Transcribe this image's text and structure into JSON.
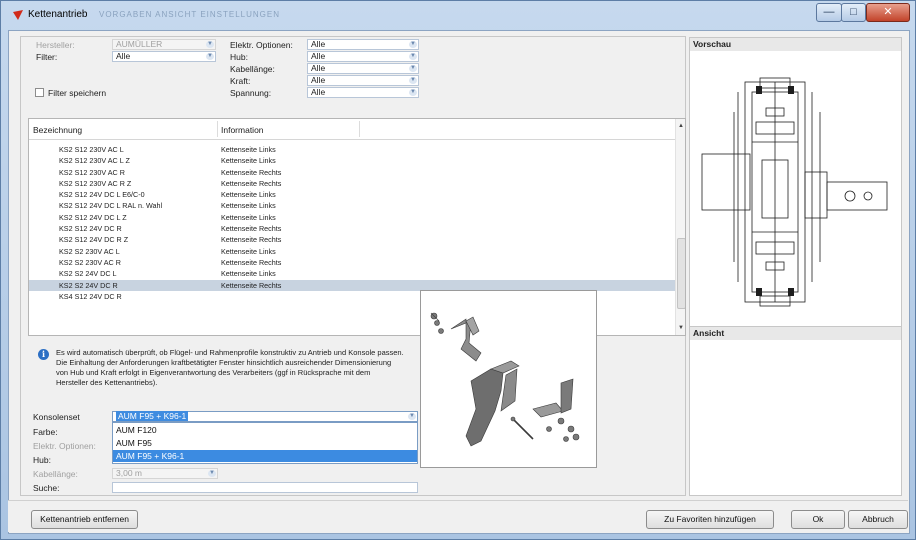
{
  "window": {
    "title": "Kettenantrieb",
    "ghost_menu": "VORGABEN ANSICHT EINSTELLUNGEN",
    "controls": {
      "minimize": "—",
      "maximize": "□",
      "close": "✕"
    }
  },
  "colors": {
    "accent": "#3c8be1",
    "selection_row": "#c8d3e0",
    "title_icon": "#d12a1a"
  },
  "filters": {
    "hersteller": {
      "label": "Hersteller:",
      "value": "AUMÜLLER"
    },
    "filter": {
      "label": "Filter:",
      "value": "Alle"
    },
    "filter_speichern": {
      "label": "Filter speichern",
      "checked": false
    },
    "elektr_optionen": {
      "label": "Elektr. Optionen:",
      "value": "Alle"
    },
    "hub": {
      "label": "Hub:",
      "value": "Alle"
    },
    "kabellaenge": {
      "label": "Kabellänge:",
      "value": "Alle"
    },
    "kraft": {
      "label": "Kraft:",
      "value": "Alle"
    },
    "spannung": {
      "label": "Spannung:",
      "value": "Alle"
    }
  },
  "list": {
    "columns": [
      "Bezeichnung",
      "Information"
    ],
    "rows": [
      {
        "name": "KS2 S12 230V AC L",
        "info": "Kettenseite Links"
      },
      {
        "name": "KS2 S12 230V AC L Z",
        "info": "Kettenseite Links"
      },
      {
        "name": "KS2 S12 230V AC R",
        "info": "Kettenseite Rechts"
      },
      {
        "name": "KS2 S12 230V AC R Z",
        "info": "Kettenseite Rechts"
      },
      {
        "name": "KS2 S12 24V DC L E6/C-0",
        "info": "Kettenseite Links"
      },
      {
        "name": "KS2 S12 24V DC L RAL n. Wahl",
        "info": "Kettenseite Links"
      },
      {
        "name": "KS2 S12 24V DC L Z",
        "info": "Kettenseite Links"
      },
      {
        "name": "KS2 S12 24V DC R",
        "info": "Kettenseite Rechts"
      },
      {
        "name": "KS2 S12 24V DC R Z",
        "info": "Kettenseite Rechts"
      },
      {
        "name": "KS2 S2 230V AC L",
        "info": "Kettenseite Links"
      },
      {
        "name": "KS2 S2 230V AC R",
        "info": "Kettenseite Rechts"
      },
      {
        "name": "KS2 S2 24V DC L",
        "info": "Kettenseite Links"
      },
      {
        "name": "KS2 S2 24V DC R",
        "info": "Kettenseite Rechts"
      },
      {
        "name": "KS4 S12 24V DC R",
        "info": ""
      }
    ],
    "selected_index": 12
  },
  "info_text": "Es wird automatisch überprüft, ob Flügel- und Rahmenprofile konstruktiv zu Antrieb und Konsole passen. Die Einhaltung der Anforderungen kraftbetätigter Fenster hinsichtlich ausreichender Dimensionierung von Hub und Kraft erfolgt in Eigenverantwortung des Verarbeiters (ggf in Rücksprache mit dem Hersteller des Kettenantriebs).",
  "form": {
    "konsolenset": {
      "label": "Konsolenset",
      "value": "AUM F95 + K96-1"
    },
    "farbe": {
      "label": "Farbe:"
    },
    "elektr_optionen": {
      "label": "Elektr. Optionen:"
    },
    "hub": {
      "label": "Hub:"
    },
    "kabellaenge": {
      "label": "Kabellänge:",
      "value": "3,00 m"
    },
    "suche": {
      "label": "Suche:",
      "value": ""
    },
    "dropdown_options": [
      "AUM F120",
      "AUM F95",
      "AUM F95 + K96-1"
    ],
    "dropdown_selected": 2
  },
  "panels": {
    "vorschau": "Vorschau",
    "ansicht": "Ansicht"
  },
  "buttons": {
    "remove": "Kettenantrieb entfernen",
    "favorites": "Zu Favoriten hinzufügen",
    "ok": "Ok",
    "cancel": "Abbruch"
  }
}
